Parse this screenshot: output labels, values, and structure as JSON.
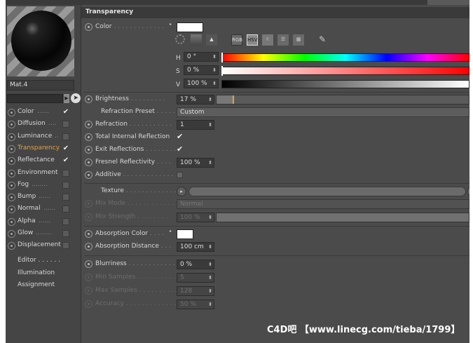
{
  "left": {
    "material_name": "Mat.4",
    "channels": [
      {
        "label": "Color",
        "dots": "......",
        "checked": true,
        "active": false
      },
      {
        "label": "Diffusion",
        "dots": "....",
        "checked": false,
        "active": false
      },
      {
        "label": "Luminance",
        "dots": "..",
        "checked": false,
        "active": false
      },
      {
        "label": "Transparency",
        "dots": "",
        "checked": true,
        "active": true
      },
      {
        "label": "Reflectance",
        "dots": "",
        "checked": true,
        "active": false
      },
      {
        "label": "Environment",
        "dots": "",
        "checked": false,
        "active": false
      },
      {
        "label": "Fog",
        "dots": "........",
        "checked": false,
        "active": false
      },
      {
        "label": "Bump",
        "dots": "......",
        "checked": false,
        "active": false
      },
      {
        "label": "Normal",
        "dots": "......",
        "checked": false,
        "active": false
      },
      {
        "label": "Alpha",
        "dots": "......",
        "checked": false,
        "active": false
      },
      {
        "label": "Glow",
        "dots": "........",
        "checked": false,
        "active": false
      },
      {
        "label": "Displacement",
        "dots": "",
        "checked": false,
        "active": false
      }
    ],
    "extras": [
      "Editor . . . . . .",
      "Illumination",
      "Assignment"
    ]
  },
  "header": {
    "title": "Transparency"
  },
  "color": {
    "label": "Color",
    "dots": ". . . . . . . . . . . . .",
    "swatch": "#ffffff"
  },
  "icons": {
    "rgb": "RGB",
    "hsv": "HSV",
    "k": "K"
  },
  "hsv": {
    "h_label": "H",
    "h_value": "0 °",
    "s_label": "S",
    "s_value": "0 %",
    "v_label": "V",
    "v_value": "100 %"
  },
  "brightness": {
    "label": "Brightness",
    "dots": ". . . . . . . . .",
    "value": "17 %",
    "level": 0.17
  },
  "refraction_preset": {
    "label": "Refraction Preset",
    "dots": ". . . . . .",
    "value": "Custom"
  },
  "refraction": {
    "label": "Refraction",
    "dots": ". . . . . . . . . . .",
    "value": "1"
  },
  "total_internal_reflection": {
    "label": "Total Internal Reflection",
    "checked": true
  },
  "exit_reflections": {
    "label": "Exit Reflections",
    "dots": ". . . . . . . .",
    "checked": true
  },
  "fresnel": {
    "label": "Fresnel Reflectivity",
    "dots": ". . . .",
    "value": "100 %"
  },
  "additive": {
    "label": "Additive",
    "dots": ". . . . . . . . . . . . .",
    "checked": false
  },
  "texture": {
    "label": "Texture",
    "dots": ". . . . . . . . . . . . . . ."
  },
  "mix_mode": {
    "label": "Mix Mode",
    "dots": ". . . . . . . . . . . .",
    "value": "Normal"
  },
  "mix_strength": {
    "label": "Mix Strength",
    "dots": ". . . . . . . .",
    "value": "100 %"
  },
  "absorption_color": {
    "label": "Absorption Color",
    "dots": ". . . .",
    "swatch": "#ffffff"
  },
  "absorption_distance": {
    "label": "Absorption Distance",
    "dots": ". . .",
    "value": "100 cm"
  },
  "blurriness": {
    "label": "Blurriness",
    "dots": ". . . . . . . . . . . . .",
    "value": "0 %"
  },
  "min_samples": {
    "label": "Min Samples",
    "dots": ". . . . . . . . . . .",
    "value": "5"
  },
  "max_samples": {
    "label": "Max Samples",
    "dots": ". . . . . . . . . .",
    "value": "128"
  },
  "accuracy": {
    "label": "Accuracy",
    "dots": ". . . . . . . . . . . . . . .",
    "value": "50 %"
  },
  "watermark": "C4D吧 【www.linecg.com/tieba/1799】",
  "colors": {
    "accent": "#e8a23a",
    "panel": "#4b4b4b",
    "header": "#3a3a3a"
  }
}
